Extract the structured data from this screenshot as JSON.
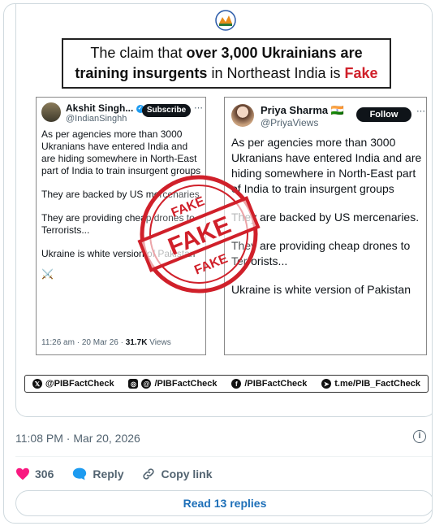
{
  "headline": {
    "part1": "The claim that ",
    "bold1": "over 3,000 Ukrainians are",
    "bold2": "training insurgents",
    "part2": " in Northeast India is ",
    "fake": "Fake"
  },
  "tweet_left": {
    "name": "Akshit Singh...",
    "handle": "@IndianSinghh",
    "button": "Subscribe",
    "paragraphs": [
      "As per agencies more than 3000 Ukranians have entered India and are hiding somewhere in North-East part of India to train insurgent groups",
      "They are backed by US mercenaries.",
      "They are providing cheap drones to Terrorists...",
      "Ukraine is white version of Pakistan"
    ],
    "emoji": "⚔️",
    "time": "11:26 am · 20 Mar 26 · ",
    "views_count": "31.7K",
    "views_label": " Views"
  },
  "tweet_right": {
    "name": "Priya Sharma",
    "flag": "🇮🇳",
    "handle": "@PriyaViews",
    "button": "Follow",
    "paragraphs": [
      "As per agencies more than 3000 Ukranians have entered India and are hiding somewhere in North-East part of India to train insurgent groups",
      "They are backed by US mercenaries.",
      "They are providing cheap drones to Terrorists...",
      "Ukraine is white version of Pakistan"
    ]
  },
  "stamp": {
    "word": "FAKE"
  },
  "social": {
    "x": "@PIBFactCheck",
    "insta": "/PIBFactCheck",
    "fb": "/PIBFactCheck",
    "tg": "t.me/PIB_FactCheck"
  },
  "post": {
    "timestamp": "11:08 PM · Mar 20, 2026",
    "likes": "306",
    "reply_label": "Reply",
    "copy_label": "Copy link",
    "read_replies": "Read 13 replies"
  },
  "colors": {
    "like": "#f91880",
    "reply": "#1d9bf0",
    "stamp": "#d0202a",
    "link": "#1d6fb8"
  }
}
